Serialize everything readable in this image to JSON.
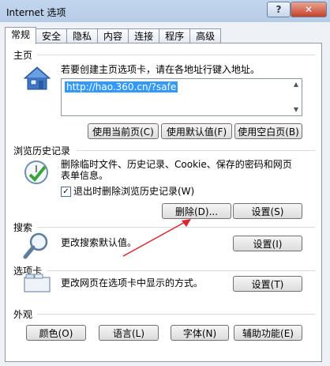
{
  "window": {
    "title": "Internet 选项",
    "help_label": "?",
    "close_label": "✕"
  },
  "tabs": [
    "常规",
    "安全",
    "隐私",
    "内容",
    "连接",
    "程序",
    "高级"
  ],
  "homepage": {
    "label": "主页",
    "desc": "若要创建主页选项卡，请在各地址行键入地址",
    "desc_suffix": "。",
    "url": "http://hao.360.cn/?safe",
    "btn_current": "使用当前页(C)",
    "btn_default": "使用默认值(F)",
    "btn_blank": "使用空白页(B)"
  },
  "history": {
    "label": "浏览历史记录",
    "desc_line1": "删除临时文件、历史记录、Cookie、保存的密码和网页",
    "desc_line2": "表单信息。",
    "checkbox_label": "退出时删除浏览历史记录(W)",
    "checkbox_checked": true,
    "btn_delete": "删除(D)...",
    "btn_settings": "设置(S)"
  },
  "search": {
    "label": "搜索",
    "desc": "更改搜索默认值。",
    "btn_settings": "设置(I)"
  },
  "tabs_section": {
    "label": "选项卡",
    "desc": "更改网页在选项卡中显示的方式。",
    "btn_settings": "设置(T)"
  },
  "appearance": {
    "label": "外观",
    "btn_colors": "颜色(O)",
    "btn_languages": "语言(L)",
    "btn_fonts": "字体(N)",
    "btn_accessibility": "辅助功能(E)"
  },
  "colors": {
    "accent": "#3399ff",
    "arrow": "#d9262b"
  }
}
